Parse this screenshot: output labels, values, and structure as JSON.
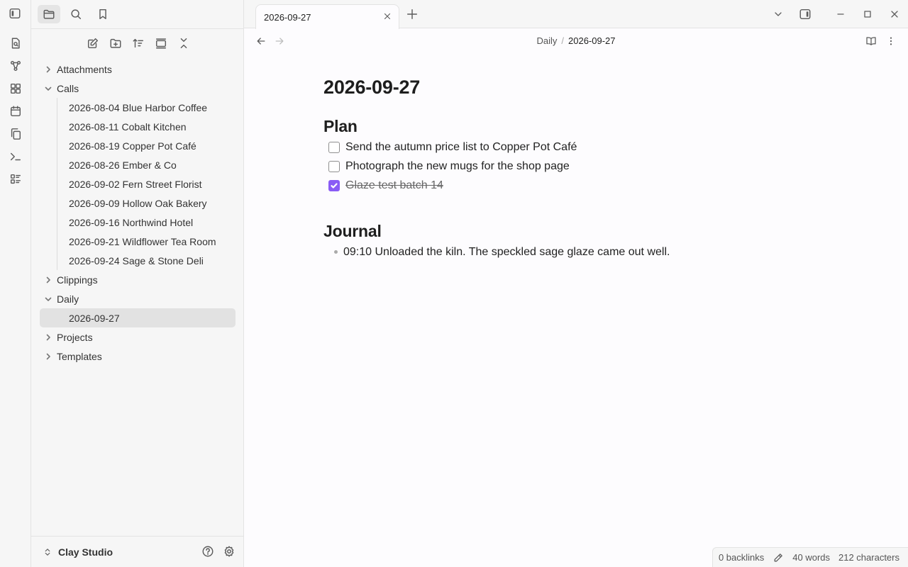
{
  "app": {
    "vault_name": "Clay Studio"
  },
  "ribbon": {
    "icons": [
      "file-search-icon",
      "graph-icon",
      "grid-icon",
      "calendar-icon",
      "copy-icon",
      "terminal-icon",
      "list-icon"
    ]
  },
  "sidebar": {
    "tabs": [
      "folder-icon",
      "search-icon",
      "bookmark-icon"
    ],
    "tree": [
      {
        "label": "Attachments",
        "expanded": false,
        "children": []
      },
      {
        "label": "Calls",
        "expanded": true,
        "children": [
          "2026-08-04 Blue Harbor Coffee",
          "2026-08-11 Cobalt Kitchen",
          "2026-08-19 Copper Pot Café",
          "2026-08-26 Ember & Co",
          "2026-09-02 Fern Street Florist",
          "2026-09-09 Hollow Oak Bakery",
          "2026-09-16 Northwind Hotel",
          "2026-09-21 Wildflower Tea Room",
          "2026-09-24 Sage & Stone Deli"
        ]
      },
      {
        "label": "Clippings",
        "expanded": false,
        "children": []
      },
      {
        "label": "Daily",
        "expanded": true,
        "children": [
          "2026-09-27"
        ]
      },
      {
        "label": "Projects",
        "expanded": false,
        "children": []
      },
      {
        "label": "Templates",
        "expanded": false,
        "children": []
      }
    ],
    "active_file": "2026-09-27"
  },
  "tabs": [
    {
      "label": "2026-09-27",
      "active": true
    }
  ],
  "breadcrumb": {
    "folder": "Daily",
    "separator": "/",
    "current": "2026-09-27"
  },
  "note": {
    "title": "2026-09-27",
    "plan_heading": "Plan",
    "tasks": [
      {
        "text": "Send the autumn price list to Copper Pot Café",
        "done": false
      },
      {
        "text": "Photograph the new mugs for the shop page",
        "done": false
      },
      {
        "text": "Glaze test batch 14",
        "done": true
      }
    ],
    "journal_heading": "Journal",
    "journal": [
      "09:10 Unloaded the kiln. The speckled sage glaze came out well."
    ]
  },
  "status": {
    "backlinks": "0 backlinks",
    "words": "40 words",
    "characters": "212 characters"
  },
  "colors": {
    "accent": "#8a5cf5",
    "sidebar_bg": "#f6f6f6",
    "editor_bg": "#fdfcfe"
  }
}
